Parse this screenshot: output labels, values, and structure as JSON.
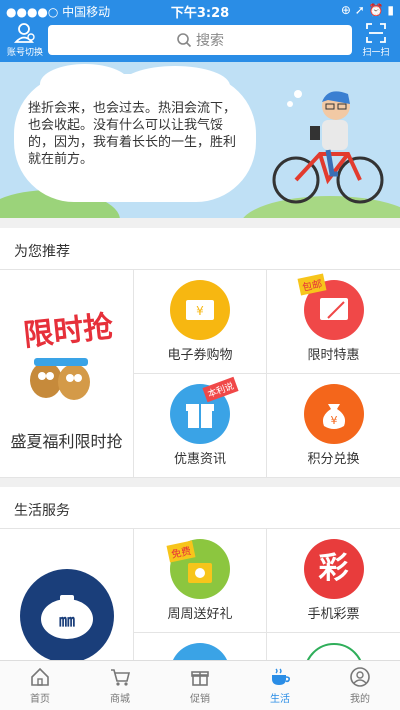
{
  "status": {
    "carrier": "●●●●○ 中国移动",
    "time": "下午3:28",
    "right": "⊕ ➚ ⏰ ▮"
  },
  "header": {
    "account_label": "账号切换",
    "search_placeholder": "搜索",
    "scan_label": "扫一扫"
  },
  "banner": {
    "text": "挫折会来，也会过去。热泪会流下，也会收起。没有什么可以让我气馁的，因为，我有着长长的一生，胜利就在前方。"
  },
  "recommend": {
    "title": "为您推荐",
    "flash_sale_badge": "限时抢",
    "flash_sale_label": "盛夏福利限时抢",
    "items": [
      {
        "label": "电子券购物",
        "color": "#f7b711"
      },
      {
        "label": "限时特惠",
        "color": "#f04848",
        "tag": "包邮"
      },
      {
        "label": "优惠资讯",
        "color": "#3aa3e6",
        "tag": "本利说"
      },
      {
        "label": "积分兑换",
        "color": "#f4661b"
      }
    ]
  },
  "life": {
    "title": "生活服务",
    "items": [
      {
        "label": "周周送好礼",
        "color": "#8cc63f",
        "tag": "免费"
      },
      {
        "label": "手机彩票",
        "color": "#e83c3c",
        "glyph": "彩"
      }
    ],
    "left_color": "#1a3e7a"
  },
  "tabs": [
    {
      "label": "首页",
      "icon": "home-icon"
    },
    {
      "label": "商城",
      "icon": "cart-icon"
    },
    {
      "label": "促销",
      "icon": "gift-icon"
    },
    {
      "label": "生活",
      "icon": "cup-icon",
      "active": true
    },
    {
      "label": "我的",
      "icon": "user-icon"
    }
  ]
}
